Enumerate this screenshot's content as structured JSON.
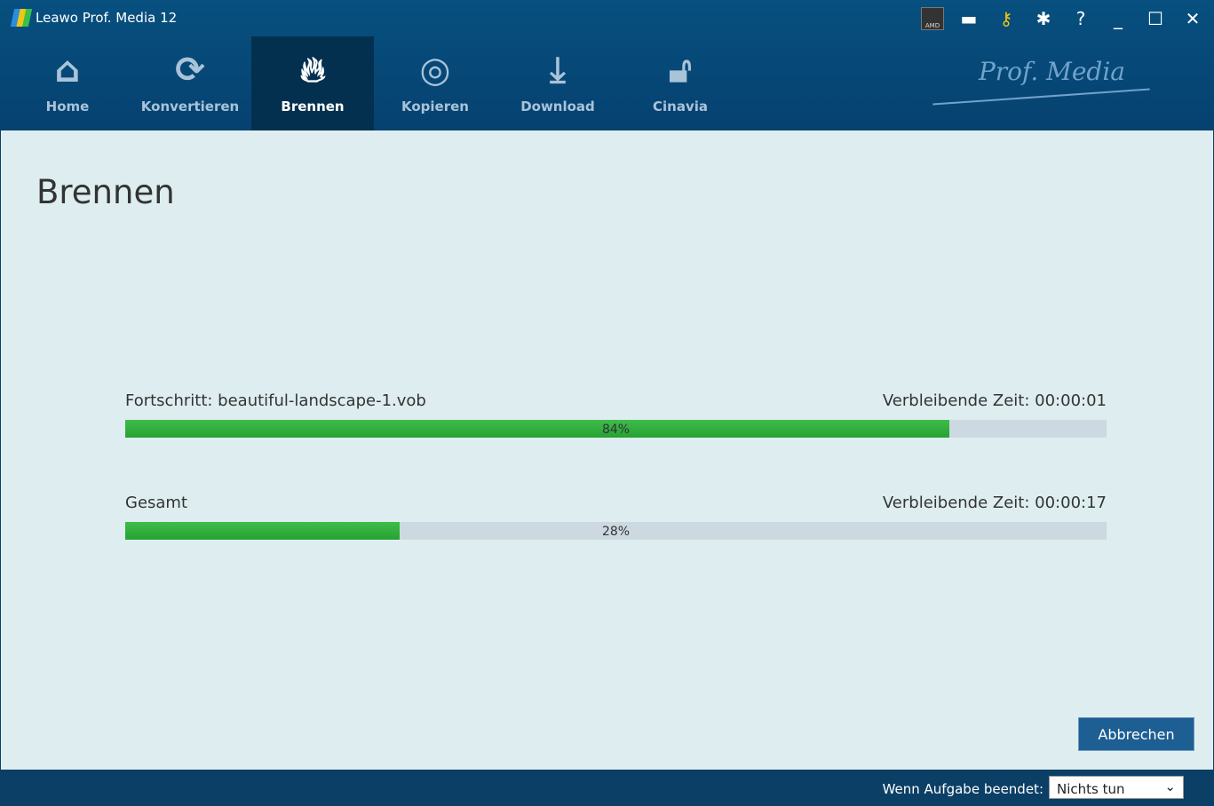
{
  "app": {
    "title": "Leawo Prof. Media 12",
    "brand": "Prof. Media"
  },
  "nav": [
    {
      "label": "Home",
      "icon": "home-icon"
    },
    {
      "label": "Konvertieren",
      "icon": "convert-icon"
    },
    {
      "label": "Brennen",
      "icon": "flame-icon",
      "active": true
    },
    {
      "label": "Kopieren",
      "icon": "disc-icon"
    },
    {
      "label": "Download",
      "icon": "download-icon"
    },
    {
      "label": "Cinavia",
      "icon": "unlock-icon"
    }
  ],
  "window_controls": {
    "amd": "AMD"
  },
  "page": {
    "title": "Brennen"
  },
  "progress": {
    "file_label": "Fortschritt: beautiful-landscape-1.vob",
    "file_remaining": "Verbleibende Zeit: 00:00:01",
    "file_percent": 84,
    "file_percent_text": "84%",
    "total_label": "Gesamt",
    "total_remaining": "Verbleibende Zeit: 00:00:17",
    "total_percent": 28,
    "total_percent_text": "28%"
  },
  "buttons": {
    "cancel": "Abbrechen"
  },
  "footer": {
    "label": "Wenn Aufgabe beendet:",
    "select_value": "Nichts tun"
  }
}
